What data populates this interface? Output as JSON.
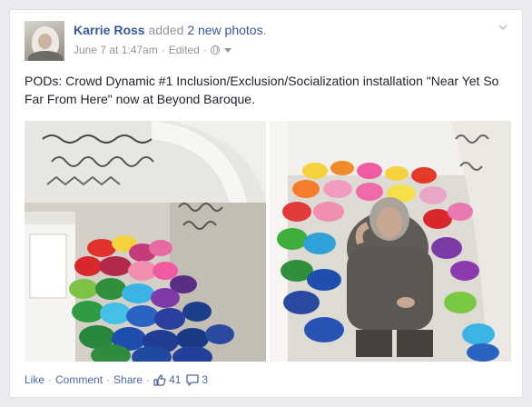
{
  "post": {
    "author": "Karrie Ross",
    "action_prefix": "added",
    "action_link": "2 new photos",
    "action_suffix": ".",
    "date": "June 7 at 1:47am",
    "edited": "Edited",
    "separator": "·",
    "text": "PODs: Crowd Dynamic #1 Inclusion/Exclusion/Socialization installation \"Near Yet So Far From Here\" now at Beyond Baroque."
  },
  "actions": {
    "like": "Like",
    "comment": "Comment",
    "share": "Share",
    "likes_count": "41",
    "comments_count": "3",
    "like_icon": "thumbs-up-icon",
    "comment_icon": "speech-bubble-icon"
  },
  "colors": {
    "link": "#365899",
    "meta": "#90949c",
    "text": "#1d2129",
    "background": "#e9ebee"
  }
}
